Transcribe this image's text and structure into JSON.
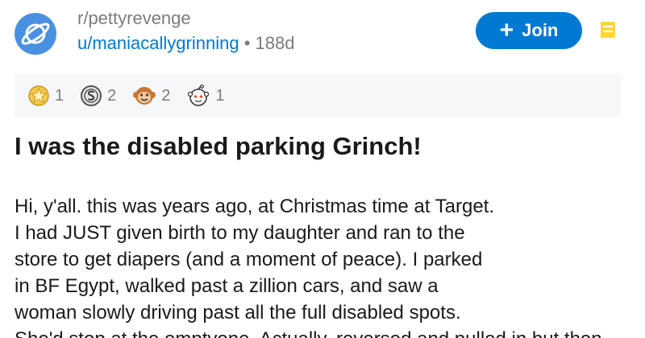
{
  "post": {
    "subreddit": "r/pettyrevenge",
    "username": "u/maniacallygrinning",
    "separator": "•",
    "age": "188d",
    "join_label": "Join",
    "join_plus": "+",
    "awards": [
      {
        "icon": "gold-star-award-icon",
        "count": "1"
      },
      {
        "icon": "silver-coin-award-icon",
        "count": "2"
      },
      {
        "icon": "monkey-face-award-icon",
        "count": "2"
      },
      {
        "icon": "snoo-face-award-icon",
        "count": "1"
      }
    ],
    "title": "I was the disabled parking Grinch!",
    "body_lines": [
      "Hi, y'all. this was years ago, at Christmas time at Target.",
      "I had JUST given birth to my daughter and ran to the",
      "store to get diapers (and a moment of peace). I parked",
      "in BF Egypt, walked past a zillion cars, and saw a",
      "woman slowly driving past all the full disabled spots.",
      "She'd stop at the emptyone. Actually, reversed and pulled in but then"
    ]
  },
  "colors": {
    "accent": "#0079d3",
    "avatar": "#4a90e2",
    "muted_text": "#7c7c7c",
    "awards_bg": "#f6f7f8",
    "menu_icon": "#ffd635"
  }
}
